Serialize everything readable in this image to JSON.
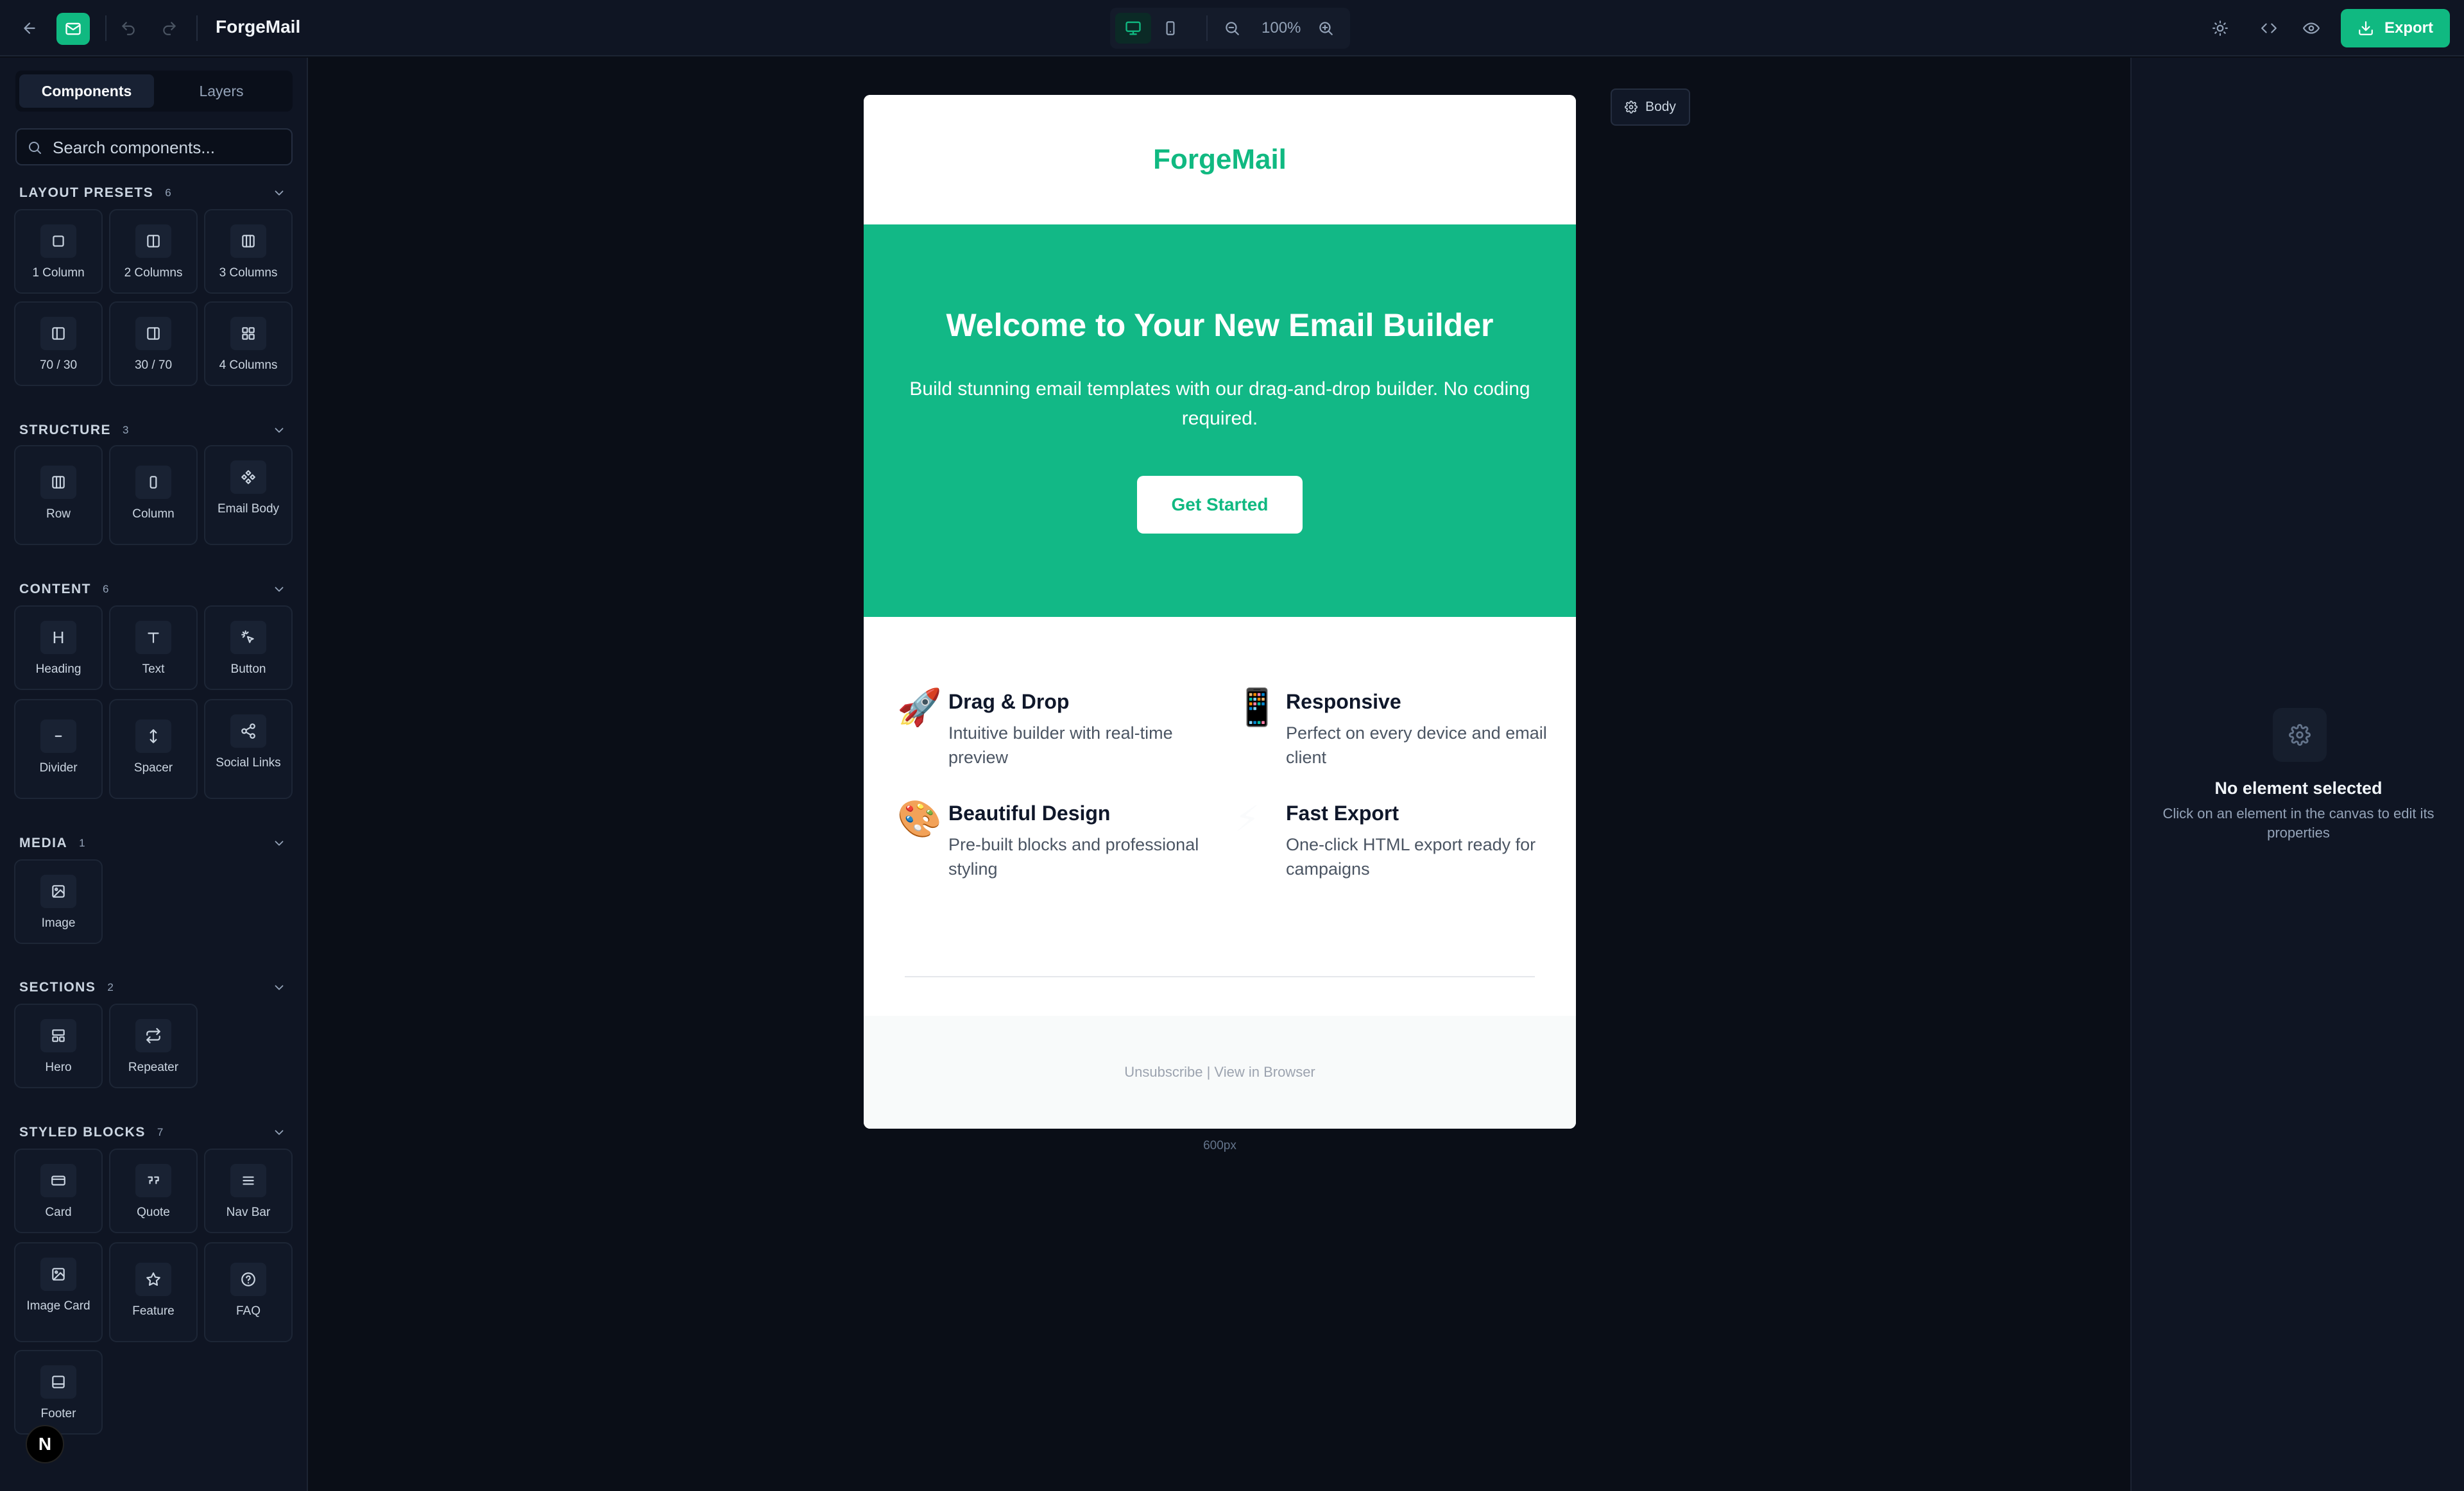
{
  "app": {
    "title": "ForgeMail",
    "zoom": "100%",
    "export_label": "Export"
  },
  "sidebar": {
    "tabs": [
      "Components",
      "Layers"
    ],
    "search_placeholder": "Search components...",
    "categories": [
      {
        "title": "LAYOUT PRESETS",
        "count": "6",
        "items": [
          "1 Column",
          "2 Columns",
          "3 Columns",
          "70 / 30",
          "30 / 70",
          "4 Columns"
        ]
      },
      {
        "title": "STRUCTURE",
        "count": "3",
        "items": [
          "Row",
          "Column",
          "Email Body"
        ]
      },
      {
        "title": "CONTENT",
        "count": "6",
        "items": [
          "Heading",
          "Text",
          "Button",
          "Divider",
          "Spacer",
          "Social Links"
        ]
      },
      {
        "title": "MEDIA",
        "count": "1",
        "items": [
          "Image"
        ]
      },
      {
        "title": "SECTIONS",
        "count": "2",
        "items": [
          "Hero",
          "Repeater"
        ]
      },
      {
        "title": "STYLED BLOCKS",
        "count": "7",
        "items": [
          "Card",
          "Quote",
          "Nav Bar",
          "Image Card",
          "Feature",
          "FAQ",
          "Footer"
        ]
      }
    ],
    "avatar_letter": "N"
  },
  "canvas": {
    "body_label": "Body",
    "width_label": "600px",
    "email": {
      "brand": "ForgeMail",
      "hero_title": "Welcome to Your New Email Builder",
      "hero_text": "Build stunning email templates with our drag-and-drop builder. No coding required.",
      "cta": "Get Started",
      "features": [
        {
          "emoji": "🚀",
          "title": "Drag & Drop",
          "desc": "Intuitive builder with real-time preview"
        },
        {
          "emoji": "📱",
          "title": "Responsive",
          "desc": "Perfect on every device and email client"
        },
        {
          "emoji": "🎨",
          "title": "Beautiful Design",
          "desc": "Pre-built blocks and professional styling"
        },
        {
          "emoji": "⚡",
          "title": "Fast Export",
          "desc": "One-click HTML export ready for campaigns"
        }
      ],
      "footer": "Unsubscribe | View in Browser"
    }
  },
  "properties": {
    "empty_title": "No element selected",
    "empty_text": "Click on an element in the canvas to edit its properties"
  },
  "colors": {
    "accent": "#10b981",
    "hero_bg": "#12b886",
    "app_bg": "#0a0e17",
    "panel_bg": "#0f1523"
  }
}
